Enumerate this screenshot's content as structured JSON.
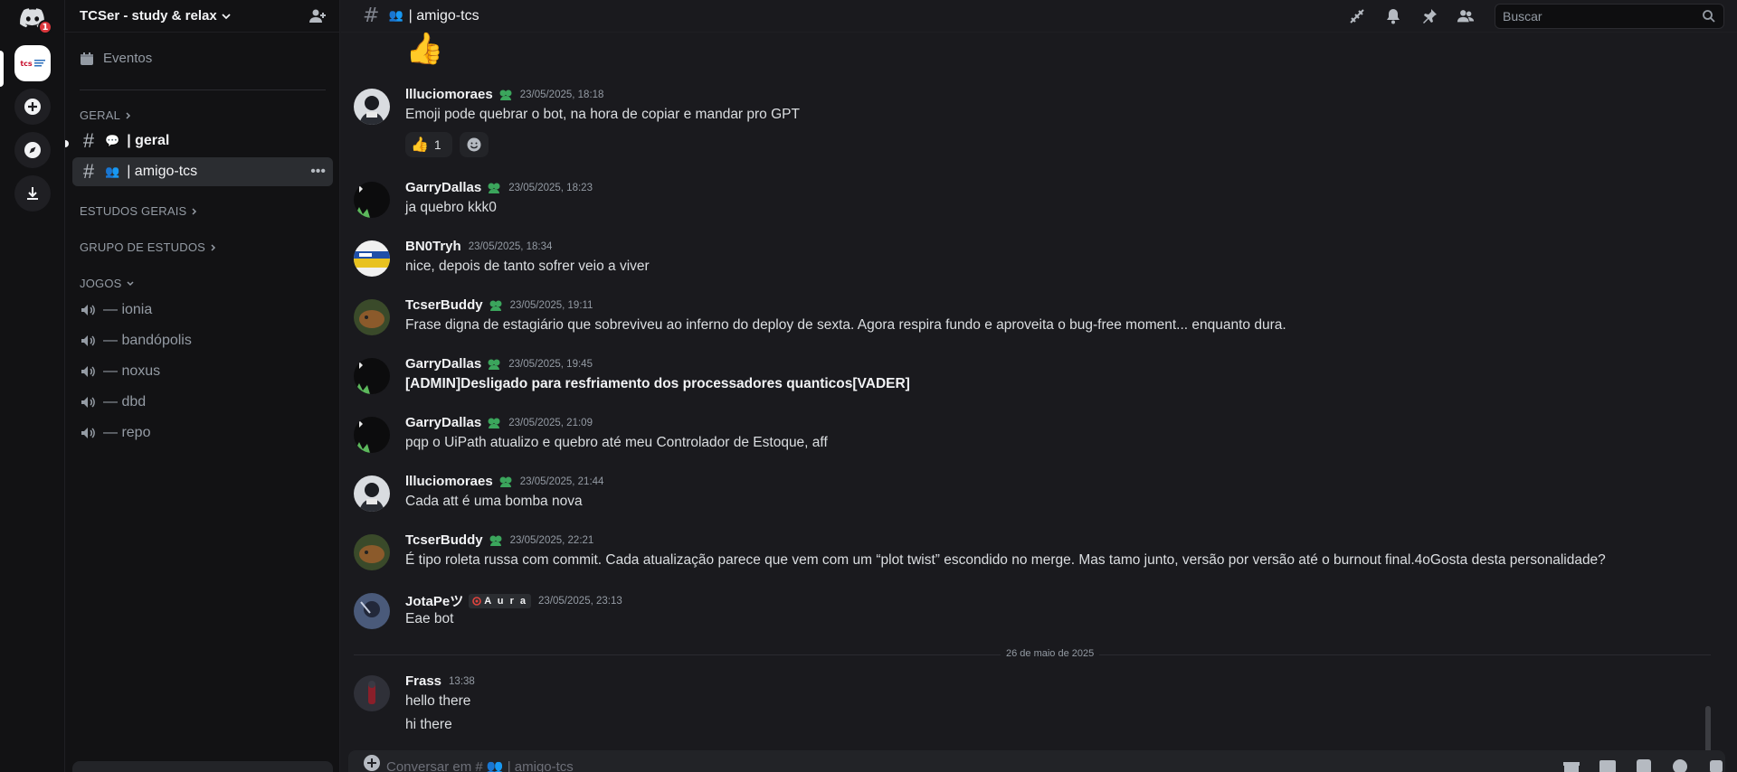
{
  "rail": {
    "notification_count": "1",
    "server_label": "tcs"
  },
  "sidebar": {
    "server_name": "TCSer - study & relax",
    "events_label": "Eventos",
    "categories": {
      "geral": "GERAL",
      "estudos": "ESTUDOS GERAIS",
      "grupo": "GRUPO DE ESTUDOS",
      "jogos": "JOGOS"
    },
    "text_channels": [
      {
        "label": "| geral",
        "emoji": "💬"
      },
      {
        "label": "| amigo-tcs",
        "emoji": "👥"
      }
    ],
    "voice_channels": [
      "— ionia",
      "— bandópolis",
      "— noxus",
      "— dbd",
      "— repo"
    ]
  },
  "topbar": {
    "channel_title": "| amigo-tcs",
    "channel_emoji": "👥",
    "search_placeholder": "Buscar"
  },
  "messages": [
    {
      "author": "llluciomoraes",
      "timestamp": "23/05/2025, 18:18",
      "text": "Emoji pode quebrar o bot, na hora de copiar e mandar pro GPT",
      "reaction_count": "1",
      "reaction_emoji": "👍"
    },
    {
      "author": "GarryDallas",
      "timestamp": "23/05/2025, 18:23",
      "text": "ja quebro kkk0"
    },
    {
      "author": "BN0Tryh",
      "timestamp": "23/05/2025, 18:34",
      "text": "nice, depois de tanto sofrer veio a viver"
    },
    {
      "author": "TcserBuddy",
      "timestamp": "23/05/2025, 19:11",
      "text": "Frase digna de estagiário que sobreviveu ao inferno do deploy de sexta. Agora respira fundo e aproveita o bug-free moment... enquanto dura."
    },
    {
      "author": "GarryDallas",
      "timestamp": "23/05/2025, 19:45",
      "text": "[ADMIN]Desligado para resfriamento dos processadores quanticos[VADER]"
    },
    {
      "author": "GarryDallas",
      "timestamp": "23/05/2025, 21:09",
      "text": "pqp o UiPath atualizo e quebro até meu Controlador de Estoque, aff"
    },
    {
      "author": "llluciomoraes",
      "timestamp": "23/05/2025, 21:44",
      "text": "Cada att é uma bomba nova"
    },
    {
      "author": "TcserBuddy",
      "timestamp": "23/05/2025, 22:21",
      "text": "É tipo roleta russa com commit. Cada atualização parece que vem com um “plot twist” escondido no merge. Mas tamo junto, versão por versão até o burnout final.4oGosta desta personalidade?"
    },
    {
      "author": "JotaPeツ",
      "tag": "A u r a",
      "timestamp": "23/05/2025, 23:13",
      "text": "Eae bot"
    },
    {
      "author": "Frass",
      "timestamp": "13:38",
      "text": "hello there",
      "text2": "hi there"
    }
  ],
  "date_separator": "26 de maio de 2025",
  "previous_emoji": "👍",
  "composer": {
    "placeholder": "Conversar em # 👥 | amigo-tcs"
  },
  "colors": {
    "background": "#1a1a1e",
    "sidebar": "#121214",
    "role_green": "#3ba55c",
    "notification_red": "#da373c"
  }
}
